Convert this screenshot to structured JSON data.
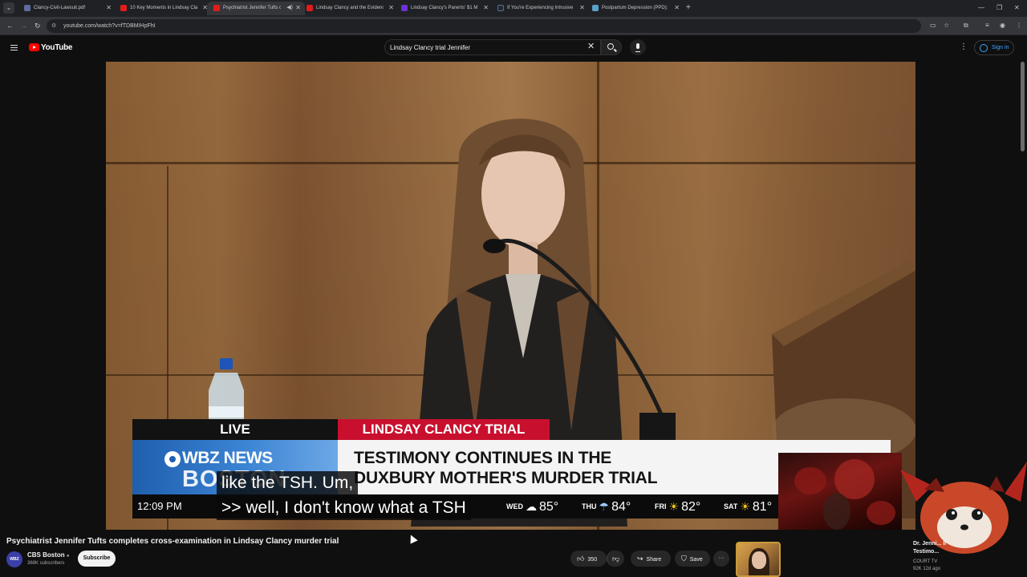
{
  "browser": {
    "tabs": [
      {
        "title": "Clancy-Civil-Lawsuit.pdf",
        "favicon": "pdf-icon"
      },
      {
        "title": "10 Key Moments in Lindsay Cla",
        "favicon": "youtube-icon"
      },
      {
        "title": "Psychiatrist Jennifer Tufts c",
        "favicon": "youtube-icon",
        "active": true,
        "audio": true
      },
      {
        "title": "Lindsay Clancy and the Evidenc",
        "favicon": "youtube-icon"
      },
      {
        "title": "Lindsay Clancy's Parents' $1 M",
        "favicon": "yahoo-icon"
      },
      {
        "title": "If You're Experiencing Intrusive",
        "favicon": "instagram-icon"
      },
      {
        "title": "Postpartum Depression (PPD): ",
        "favicon": "medical-icon"
      }
    ],
    "url": "youtube.com/watch?v=fTDBMIHpFhI"
  },
  "youtube": {
    "logo_text": "YouTube",
    "search_value": "Lindsay Clancy trial Jennifer",
    "signin_label": "Sign in"
  },
  "video": {
    "overlay": {
      "live_label": "LIVE",
      "trial_label": "LINDSAY CLANCY TRIAL",
      "network": "WBZ NEWS",
      "city": "BOSTON",
      "headline_line1": "TESTIMONY CONTINUES IN THE",
      "headline_line2": "DUXBURY MOTHER'S MURDER TRIAL",
      "time": "12:09 PM",
      "weather": [
        {
          "day": "WED",
          "temp": "85°",
          "icon": "partly-cloudy-icon"
        },
        {
          "day": "THU",
          "temp": "84°",
          "icon": "rain-cloud-icon"
        },
        {
          "day": "FRI",
          "temp": "82°",
          "icon": "sun-icon"
        },
        {
          "day": "SAT",
          "temp": "81°",
          "icon": "sun-icon"
        }
      ]
    },
    "captions": [
      "like the TSH. Um,",
      ">> well, I don't know what a TSH"
    ]
  },
  "watch": {
    "title": "Psychiatrist Jennifer Tufts completes cross-examination in Lindsay Clancy murder trial",
    "channel": {
      "name": "CBS Boston",
      "avatar_text": "WBZ",
      "subscribers": "368K subscribers",
      "subscribe_label": "Subscribe"
    },
    "actions": {
      "likes": "350",
      "share_label": "Share",
      "save_label": "Save"
    }
  },
  "related": {
    "title": "Dr. Jenni...                ll",
    "title_line2": "Testimo...",
    "channel": "COURT TV",
    "meta": "92K   12d ago"
  },
  "colors": {
    "youtube_red": "#ff0000",
    "trial_red": "#c8102e",
    "wbz_blue": "#1f5fae",
    "signin_blue": "#3ea6ff"
  }
}
